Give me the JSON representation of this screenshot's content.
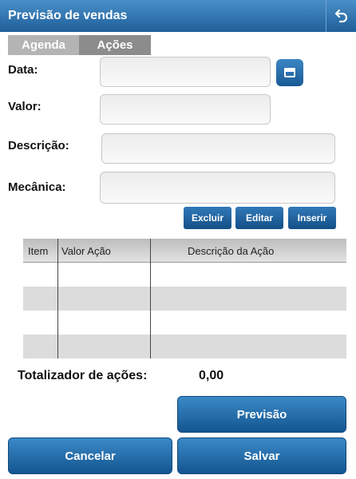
{
  "header": {
    "title": "Previsão de vendas"
  },
  "tabs": [
    {
      "label": "Agenda"
    },
    {
      "label": "Ações"
    }
  ],
  "form": {
    "data_label": "Data:",
    "valor_label": "Valor:",
    "descricao_label": "Descrição:",
    "mecanica_label": "Mecânica:",
    "data_value": "",
    "valor_value": "",
    "descricao_value": "",
    "mecanica_value": ""
  },
  "actions": {
    "excluir": "Excluir",
    "editar": "Editar",
    "inserir": "Inserir"
  },
  "grid": {
    "columns": [
      "Item",
      "Valor Ação",
      "Descrição da Ação"
    ],
    "rows": [
      [
        "",
        "",
        ""
      ],
      [
        "",
        "",
        ""
      ],
      [
        "",
        "",
        ""
      ],
      [
        "",
        "",
        ""
      ]
    ]
  },
  "totals": {
    "label": "Totalizador de ações:",
    "value": "0,00"
  },
  "buttons": {
    "previsao": "Previsão",
    "cancelar": "Cancelar",
    "salvar": "Salvar"
  },
  "colors": {
    "accent": "#1f5f9a",
    "tab_active": "#8c8c8c",
    "tab_inactive": "#b4b4b4"
  },
  "icons": {
    "back": "undo-arrow-icon",
    "calendar": "calendar-icon"
  }
}
